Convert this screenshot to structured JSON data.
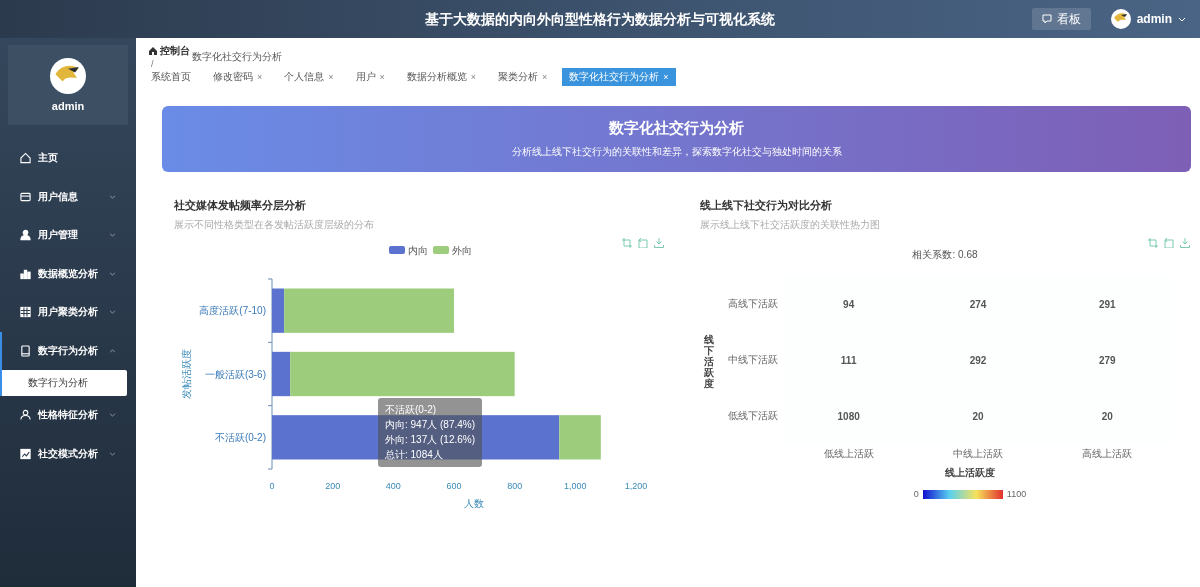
{
  "header": {
    "title": "基于大数据的内向外向型性格行为数据分析与可视化系统",
    "board_button": "看板",
    "user": "admin"
  },
  "sidebar": {
    "profile_name": "admin",
    "menu": [
      {
        "label": "主页",
        "has_children": false,
        "expanded": false
      },
      {
        "label": "用户信息",
        "has_children": true,
        "expanded": false
      },
      {
        "label": "用户管理",
        "has_children": true,
        "expanded": false
      },
      {
        "label": "数据概览分析",
        "has_children": true,
        "expanded": false
      },
      {
        "label": "用户聚类分析",
        "has_children": true,
        "expanded": false
      },
      {
        "label": "数字行为分析",
        "has_children": true,
        "expanded": true,
        "children": [
          {
            "label": "数字行为分析",
            "selected": true
          }
        ]
      },
      {
        "label": "性格特征分析",
        "has_children": true,
        "expanded": false
      },
      {
        "label": "社交模式分析",
        "has_children": true,
        "expanded": false
      }
    ]
  },
  "breadcrumb": {
    "home": "控制台",
    "separator": "/",
    "current": "数字化社交行为分析"
  },
  "tabs": [
    {
      "label": "系统首页",
      "selected": false,
      "closable": false
    },
    {
      "label": "修改密码",
      "selected": false,
      "closable": true
    },
    {
      "label": "个人信息",
      "selected": false,
      "closable": true
    },
    {
      "label": "用户",
      "selected": false,
      "closable": true
    },
    {
      "label": "数据分析概览",
      "selected": false,
      "closable": true
    },
    {
      "label": "聚类分析",
      "selected": false,
      "closable": true
    },
    {
      "label": "数字化社交行为分析",
      "selected": true,
      "closable": true
    }
  ],
  "close_glyph": "×",
  "banner": {
    "title": "数字化社交行为分析",
    "subtitle": "分析线上线下社交行为的关联性和差异，探索数字化社交与独处时间的关系"
  },
  "posting_panel": {
    "title": "社交媒体发帖频率分层分析",
    "subtitle": "展示不同性格类型在各发帖活跃度层级的分布",
    "chart_data": {
      "type": "bar",
      "orientation": "horizontal",
      "stacked": true,
      "legend": "top",
      "xlabel": "人数",
      "ylabel": "发帖活跃度",
      "categories": [
        "高度活跃(7-10)",
        "一般活跃(3-6)",
        "不活跃(0-2)"
      ],
      "series": [
        {
          "name": "内向",
          "color": "#5b73cf",
          "values": [
            40,
            60,
            947
          ]
        },
        {
          "name": "外向",
          "color": "#9ccc7c",
          "values": [
            560,
            740,
            137
          ]
        }
      ],
      "xlim": [
        0,
        1200
      ],
      "xticks": [
        {
          "value": 0,
          "label": "0"
        },
        {
          "value": 200,
          "label": "200"
        },
        {
          "value": 400,
          "label": "400"
        },
        {
          "value": 600,
          "label": "600"
        },
        {
          "value": 800,
          "label": "800"
        },
        {
          "value": 1000,
          "label": "1,000"
        },
        {
          "value": 1200,
          "label": "1,200"
        }
      ]
    },
    "tooltip": [
      "不活跃(0-2)",
      "内向: 947人 (87.4%)",
      "外向: 137人 (12.6%)",
      "总计: 1084人"
    ]
  },
  "heatmap_panel": {
    "title": "线上线下社交行为对比分析",
    "subtitle": "展示线上线下社交活跃度的关联性热力图",
    "correlation": "相关系数: 0.68",
    "y_axis_name": "线下活跃度",
    "rows": [
      {
        "label": "高线下活跃",
        "cells": [
          "94",
          "274",
          "291"
        ]
      },
      {
        "label": "中线下活跃",
        "cells": [
          "111",
          "292",
          "279"
        ]
      },
      {
        "label": "低线下活跃",
        "cells": [
          "1080",
          "20",
          "20"
        ]
      }
    ],
    "x_axis": {
      "labels": [
        "低线上活跃",
        "中线上活跃",
        "高线上活跃"
      ],
      "name": "线上活跃度"
    },
    "scale_min": "0",
    "scale_max": "1100"
  }
}
